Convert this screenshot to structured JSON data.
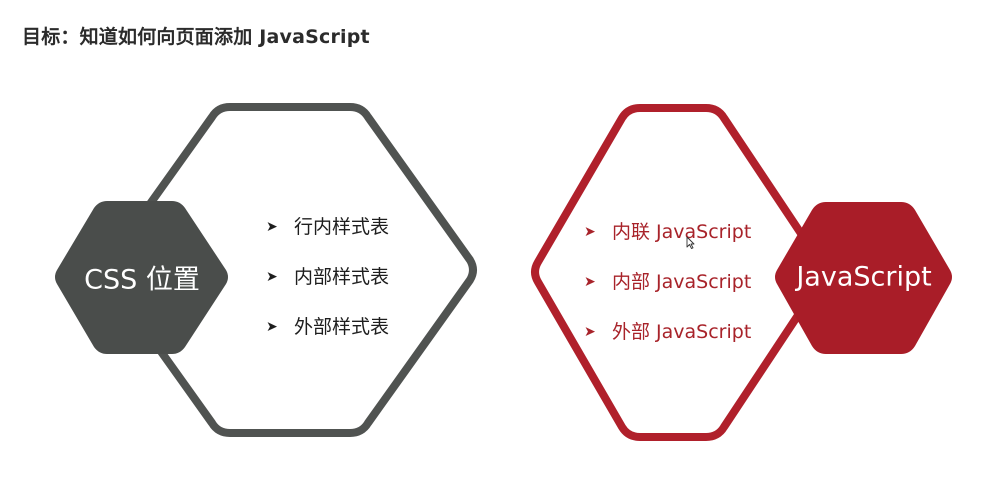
{
  "title": "目标：知道如何向页面添加 JavaScript",
  "colors": {
    "dark": "#4a4d4b",
    "red": "#a91d28",
    "outline_dark": "#505351",
    "outline_red": "#b0202b"
  },
  "css_group": {
    "label": "CSS 位置",
    "bullet_icon": "arrow-bullet-icon",
    "items": [
      "行内样式表",
      "内部样式表",
      "外部样式表"
    ]
  },
  "js_group": {
    "label": "JavaScript",
    "bullet_icon": "arrow-bullet-icon",
    "items": [
      "内联 JavaScript",
      "内部 JavaScript",
      "外部 JavaScript"
    ]
  },
  "cursor_icon": "mouse-cursor-icon"
}
